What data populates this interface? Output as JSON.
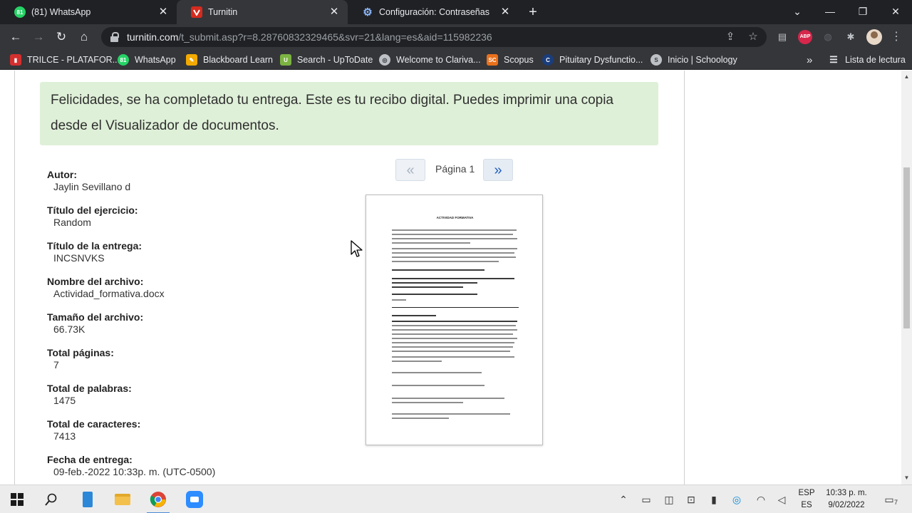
{
  "browser": {
    "tabs": [
      {
        "title": "(81) WhatsApp",
        "badge": "81",
        "icon": "whatsapp-icon",
        "color": "#25d366",
        "active": false
      },
      {
        "title": "Turnitin",
        "badge": "",
        "icon": "turnitin-icon",
        "color": "#d52b1e",
        "active": true
      },
      {
        "title": "Configuración: Contraseñas",
        "badge": "",
        "icon": "settings-gear-icon",
        "color": "#8ab4f8",
        "active": false
      }
    ],
    "url_host": "turnitin.com",
    "url_path": "/t_submit.asp?r=8.28760832329465&svr=21&lang=es&aid=115982236",
    "ext_abp": "ABP",
    "bookmarks": [
      {
        "label": "TRILCE - PLATAFOR...",
        "icon": "trilce-icon",
        "color": "#d32f2f"
      },
      {
        "label": "WhatsApp",
        "icon": "whatsapp-icon",
        "color": "#25d366"
      },
      {
        "label": "Blackboard Learn",
        "icon": "blackboard-icon",
        "color": "#f2a900"
      },
      {
        "label": "Search - UpToDate",
        "icon": "uptodate-icon",
        "color": "#7cb342"
      },
      {
        "label": "Welcome to Clariva...",
        "icon": "globe-icon",
        "color": "#bdc1c6"
      },
      {
        "label": "Scopus",
        "icon": "scopus-icon",
        "color": "#e9711c"
      },
      {
        "label": "Pituitary Dysfunctio...",
        "icon": "clinical-key-icon",
        "color": "#1a3d7c"
      },
      {
        "label": "Inicio | Schoology",
        "icon": "schoology-icon",
        "color": "#bdc1c6"
      }
    ],
    "bookmarks_more": "»",
    "reading_list": "Lista de lectura",
    "theme": {
      "bar": "#35363a",
      "strip": "#202124",
      "text": "#e8eaed"
    }
  },
  "page": {
    "alert": "Felicidades, se ha completado tu entrega. Este es tu recibo digital. Puedes imprimir una copia desde el Visualizador de documentos.",
    "alert_color": "#dff0d8",
    "meta": [
      {
        "label": "Autor:",
        "value": "Jaylin Sevillano d"
      },
      {
        "label": "Título del ejercicio:",
        "value": "Random"
      },
      {
        "label": "Título de la entrega:",
        "value": "INCSNVKS"
      },
      {
        "label": "Nombre del archivo:",
        "value": "Actividad_formativa.docx"
      },
      {
        "label": "Tamaño del archivo:",
        "value": "66.73K"
      },
      {
        "label": "Total páginas:",
        "value": "7"
      },
      {
        "label": "Total de palabras:",
        "value": "1475"
      },
      {
        "label": "Total de caracteres:",
        "value": "7413"
      },
      {
        "label": "Fecha de entrega:",
        "value": "09-feb.-2022 10:33p. m. (UTC-0500)"
      }
    ],
    "pager": {
      "prev": "«",
      "label": "Página 1",
      "next": "»"
    },
    "doc_title": "ACTIVIDAD FORMATIVA"
  },
  "taskbar": {
    "lang_top": "ESP",
    "lang_bottom": "ES",
    "time": "10:33 p. m.",
    "date": "9/02/2022",
    "notifications": "7"
  }
}
